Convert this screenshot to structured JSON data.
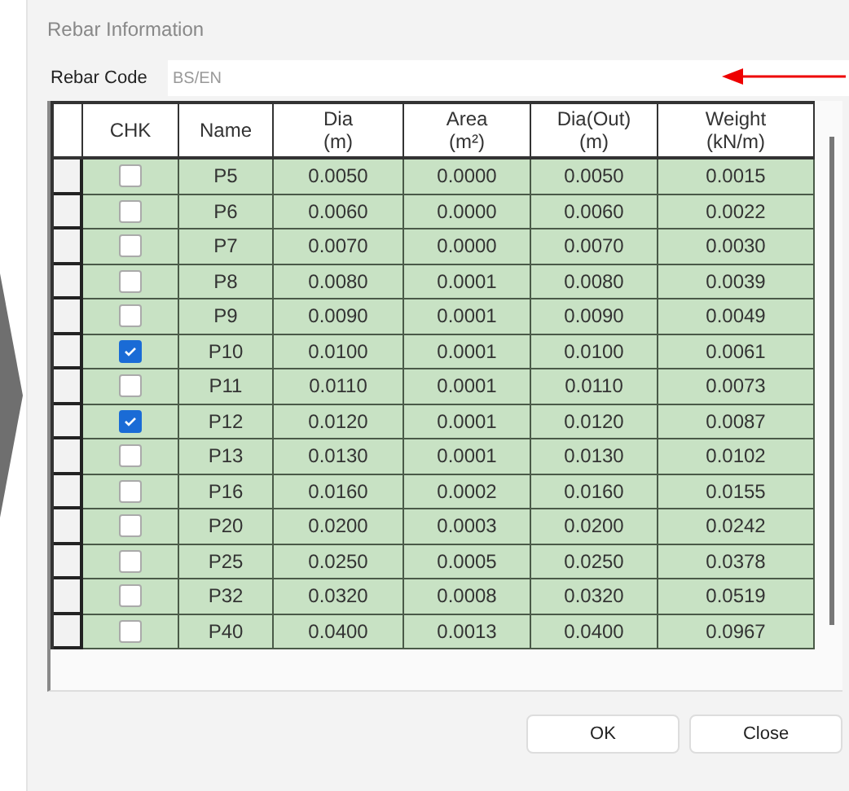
{
  "window": {
    "title": "Rebar Information"
  },
  "rebar_code": {
    "label": "Rebar Code",
    "value": "BS/EN"
  },
  "table": {
    "columns": [
      {
        "name": "CHK"
      },
      {
        "name": "Name"
      },
      {
        "name": "Dia",
        "unit": "(m)"
      },
      {
        "name": "Area",
        "unit": "(m²)"
      },
      {
        "name": "Dia(Out)",
        "unit": "(m)"
      },
      {
        "name": "Weight",
        "unit": "(kN/m)"
      }
    ],
    "rows": [
      {
        "checked": false,
        "name": "P5",
        "dia": "0.0050",
        "area": "0.0000",
        "dia_out": "0.0050",
        "weight": "0.0015"
      },
      {
        "checked": false,
        "name": "P6",
        "dia": "0.0060",
        "area": "0.0000",
        "dia_out": "0.0060",
        "weight": "0.0022"
      },
      {
        "checked": false,
        "name": "P7",
        "dia": "0.0070",
        "area": "0.0000",
        "dia_out": "0.0070",
        "weight": "0.0030"
      },
      {
        "checked": false,
        "name": "P8",
        "dia": "0.0080",
        "area": "0.0001",
        "dia_out": "0.0080",
        "weight": "0.0039"
      },
      {
        "checked": false,
        "name": "P9",
        "dia": "0.0090",
        "area": "0.0001",
        "dia_out": "0.0090",
        "weight": "0.0049"
      },
      {
        "checked": true,
        "name": "P10",
        "dia": "0.0100",
        "area": "0.0001",
        "dia_out": "0.0100",
        "weight": "0.0061"
      },
      {
        "checked": false,
        "name": "P11",
        "dia": "0.0110",
        "area": "0.0001",
        "dia_out": "0.0110",
        "weight": "0.0073"
      },
      {
        "checked": true,
        "name": "P12",
        "dia": "0.0120",
        "area": "0.0001",
        "dia_out": "0.0120",
        "weight": "0.0087"
      },
      {
        "checked": false,
        "name": "P13",
        "dia": "0.0130",
        "area": "0.0001",
        "dia_out": "0.0130",
        "weight": "0.0102"
      },
      {
        "checked": false,
        "name": "P16",
        "dia": "0.0160",
        "area": "0.0002",
        "dia_out": "0.0160",
        "weight": "0.0155"
      },
      {
        "checked": false,
        "name": "P20",
        "dia": "0.0200",
        "area": "0.0003",
        "dia_out": "0.0200",
        "weight": "0.0242"
      },
      {
        "checked": false,
        "name": "P25",
        "dia": "0.0250",
        "area": "0.0005",
        "dia_out": "0.0250",
        "weight": "0.0378"
      },
      {
        "checked": false,
        "name": "P32",
        "dia": "0.0320",
        "area": "0.0008",
        "dia_out": "0.0320",
        "weight": "0.0519"
      },
      {
        "checked": false,
        "name": "P40",
        "dia": "0.0400",
        "area": "0.0013",
        "dia_out": "0.0400",
        "weight": "0.0967"
      }
    ]
  },
  "buttons": [
    "OK",
    "Close"
  ]
}
